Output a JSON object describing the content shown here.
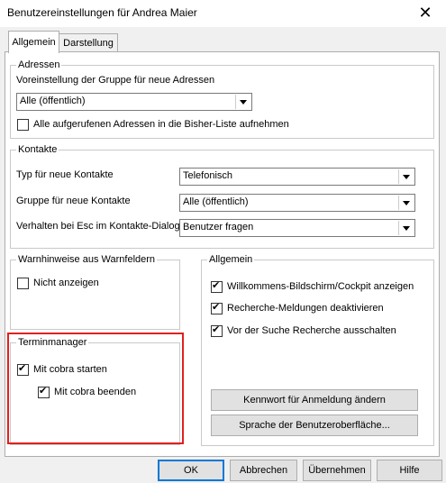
{
  "window": {
    "title": "Benutzereinstellungen für Andrea Maier"
  },
  "tabs": [
    {
      "label": "Allgemein"
    },
    {
      "label": "Darstellung"
    }
  ],
  "adressen": {
    "title": "Adressen",
    "group_label": "Voreinstellung der Gruppe für neue Adressen",
    "group_value": "Alle (öffentlich)",
    "bisher_checkbox_label": "Alle aufgerufenen Adressen in die Bisher-Liste aufnehmen"
  },
  "kontakte": {
    "title": "Kontakte",
    "typ_label": "Typ für neue Kontakte",
    "typ_value": "Telefonisch",
    "gruppe_label": "Gruppe für neue Kontakte",
    "gruppe_value": "Alle (öffentlich)",
    "esc_label": "Verhalten bei Esc im Kontakte-Dialog",
    "esc_value": "Benutzer fragen"
  },
  "warnhinweise": {
    "title": "Warnhinweise aus Warnfeldern",
    "nicht_anzeigen_label": "Nicht anzeigen"
  },
  "allgemein": {
    "title": "Allgemein",
    "willkommen_label": "Willkommens-Bildschirm/Cockpit anzeigen",
    "recherche_meldungen_label": "Recherche-Meldungen deaktivieren",
    "vor_suche_label": "Vor der Suche Recherche ausschalten",
    "kennwort_button": "Kennwort für Anmeldung ändern",
    "sprache_button": "Sprache der Benutzeroberfläche..."
  },
  "terminmanager": {
    "title": "Terminmanager",
    "starten_label": "Mit cobra starten",
    "beenden_label": "Mit cobra beenden"
  },
  "footer": {
    "ok": "OK",
    "abbrechen": "Abbrechen",
    "uebernehmen": "Übernehmen",
    "hilfe": "Hilfe"
  }
}
